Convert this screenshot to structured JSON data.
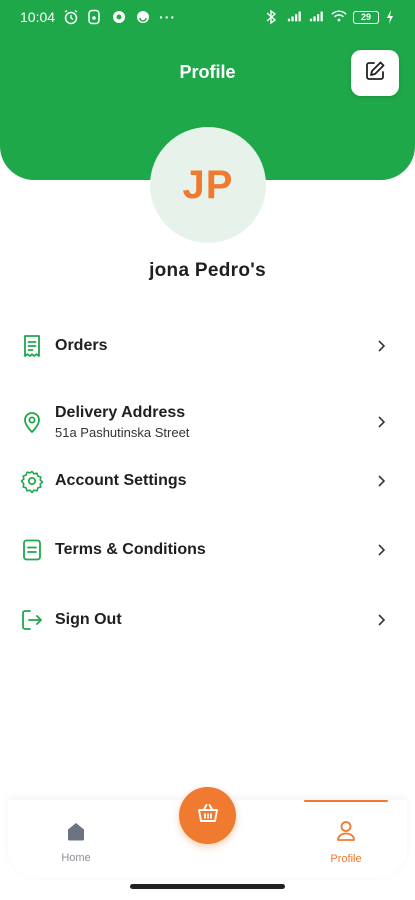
{
  "status_bar": {
    "time": "10:04",
    "more_dots": "···",
    "battery": "29",
    "icons_left": [
      "alarm-icon",
      "notification-icon",
      "app-icon",
      "app-icon"
    ],
    "icons_right": [
      "bluetooth-icon",
      "signal-icon",
      "signal-icon",
      "wifi-icon",
      "battery-icon",
      "charging-icon"
    ]
  },
  "header": {
    "title": "Profile",
    "edit_icon": "edit-icon"
  },
  "profile": {
    "initials": "JP",
    "name": "jona Pedro's"
  },
  "menu": {
    "items": [
      {
        "label": "Orders",
        "icon": "receipt-icon"
      },
      {
        "label": "Delivery Address",
        "sub": "51a Pashutinska Street",
        "icon": "location-pin-icon"
      },
      {
        "label": "Account Settings",
        "icon": "gear-icon"
      },
      {
        "label": "Terms & Conditions",
        "icon": "document-icon"
      },
      {
        "label": "Sign Out",
        "icon": "sign-out-icon"
      }
    ]
  },
  "bottom_nav": {
    "home_label": "Home",
    "profile_label": "Profile",
    "cart_icon": "basket-icon"
  },
  "colors": {
    "brand_green": "#1ea84a",
    "accent_orange": "#f07a2f",
    "avatar_bg": "#e7f3ea"
  }
}
